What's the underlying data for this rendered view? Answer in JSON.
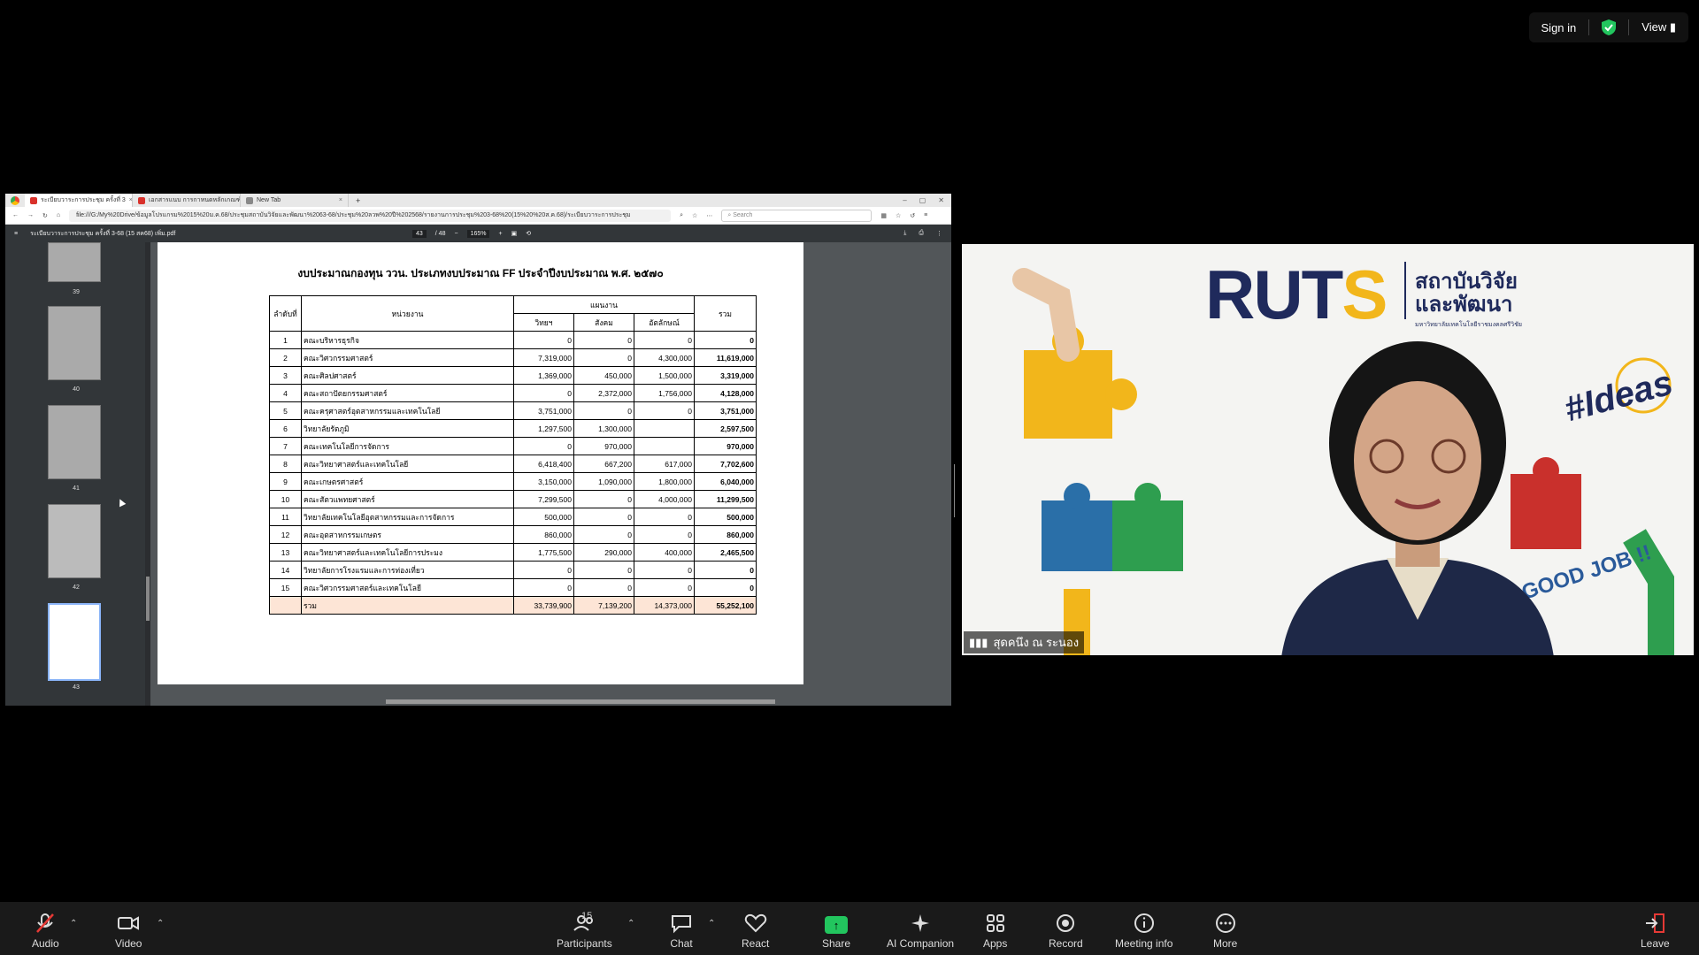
{
  "top_bar": {
    "sign_in": "Sign in",
    "view": "View"
  },
  "browser": {
    "tabs": [
      {
        "label": "ระเบียบวาระการประชุม ครั้งที่ 3"
      },
      {
        "label": "เอกสารแนบ การกาหนดหลักเกณฑ์"
      },
      {
        "label": "New Tab"
      }
    ],
    "url": "file:///G:/My%20Drive/ข้อมูลโปรแกรม%2015%20ม.ค.68/ประชุมสถาบันวิจัยและพัฒนา%2063-68/ประชุม%20ลวพ%20ปี%202568/รายงานการประชุม%203-68%20(15%20%20ส.ค.68)/ระเบียบวาระการประชุม",
    "search_placeholder": "Search"
  },
  "pdf": {
    "filename": "ระเบียบวาระการประชุม ครั้งที่ 3-68 (15 สค68) เพิ่ม.pdf",
    "page_current": "43",
    "page_total": "/ 48",
    "zoom": "165%",
    "thumbnails": [
      "39",
      "40",
      "41",
      "42",
      "43"
    ],
    "document_title": "งบประมาณกองทุน ววน. ประเภทงบประมาณ FF ประจำปีงบประมาณ พ.ศ. ๒๕๗๐",
    "table": {
      "headers": {
        "no": "ลำดับที่",
        "unit": "หน่วยงาน",
        "plan": "แผนงาน",
        "science": "วิทยฯ",
        "social": "สังคม",
        "identity": "อัตลักษณ์",
        "total": "รวม"
      },
      "rows": [
        {
          "no": "1",
          "unit": "คณะบริหารธุรกิจ",
          "science": "0",
          "social": "0",
          "identity": "0",
          "total": "0"
        },
        {
          "no": "2",
          "unit": "คณะวิศวกรรมศาสตร์",
          "science": "7,319,000",
          "social": "0",
          "identity": "4,300,000",
          "total": "11,619,000"
        },
        {
          "no": "3",
          "unit": "คณะศิลปศาสตร์",
          "science": "1,369,000",
          "social": "450,000",
          "identity": "1,500,000",
          "total": "3,319,000"
        },
        {
          "no": "4",
          "unit": "คณะสถาปัตยกรรมศาสตร์",
          "science": "0",
          "social": "2,372,000",
          "identity": "1,756,000",
          "total": "4,128,000"
        },
        {
          "no": "5",
          "unit": "คณะครุศาสตร์อุตสาหกรรมและเทคโนโลยี",
          "science": "3,751,000",
          "social": "0",
          "identity": "0",
          "total": "3,751,000"
        },
        {
          "no": "6",
          "unit": "วิทยาลัยรัตภูมิ",
          "science": "1,297,500",
          "social": "1,300,000",
          "identity": "",
          "total": "2,597,500"
        },
        {
          "no": "7",
          "unit": "คณะเทคโนโลยีการจัดการ",
          "science": "0",
          "social": "970,000",
          "identity": "",
          "total": "970,000"
        },
        {
          "no": "8",
          "unit": "คณะวิทยาศาสตร์และเทคโนโลยี",
          "science": "6,418,400",
          "social": "667,200",
          "identity": "617,000",
          "total": "7,702,600"
        },
        {
          "no": "9",
          "unit": "คณะเกษตรศาสตร์",
          "science": "3,150,000",
          "social": "1,090,000",
          "identity": "1,800,000",
          "total": "6,040,000"
        },
        {
          "no": "10",
          "unit": "คณะสัตวแพทยศาสตร์",
          "science": "7,299,500",
          "social": "0",
          "identity": "4,000,000",
          "total": "11,299,500"
        },
        {
          "no": "11",
          "unit": "วิทยาลัยเทคโนโลยีอุตสาหกรรมและการจัดการ",
          "science": "500,000",
          "social": "0",
          "identity": "0",
          "total": "500,000"
        },
        {
          "no": "12",
          "unit": "คณะอุตสาหกรรมเกษตร",
          "science": "860,000",
          "social": "0",
          "identity": "0",
          "total": "860,000"
        },
        {
          "no": "13",
          "unit": "คณะวิทยาศาสตร์และเทคโนโลยีการประมง",
          "science": "1,775,500",
          "social": "290,000",
          "identity": "400,000",
          "total": "2,465,500"
        },
        {
          "no": "14",
          "unit": "วิทยาลัยการโรงแรมและการท่องเที่ยว",
          "science": "0",
          "social": "0",
          "identity": "0",
          "total": "0"
        },
        {
          "no": "15",
          "unit": "คณะวิศวกรรมศาสตร์และเทคโนโลยี",
          "science": "0",
          "social": "0",
          "identity": "0",
          "total": "0"
        }
      ],
      "total_row": {
        "label": "รวม",
        "science": "33,739,900",
        "social": "7,139,200",
        "identity": "14,373,000",
        "total": "55,252,100"
      }
    }
  },
  "video": {
    "logo_text": "RUTS",
    "org_th_line1": "สถาบันวิจัย",
    "org_th_line2": "และพัฒนา",
    "org_sub": "มหาวิทยาลัยเทคโนโลยีราชมงคลศรีวิชัย",
    "ideas_text": "#Ideas",
    "goodjob_text": "GOOD JOB !!",
    "participant_name": "สุดคนึง ณ ระนอง"
  },
  "toolbar": {
    "audio": "Audio",
    "video": "Video",
    "participants": "Participants",
    "participants_count": "15",
    "chat": "Chat",
    "react": "React",
    "share": "Share",
    "ai_companion": "AI Companion",
    "apps": "Apps",
    "record": "Record",
    "meeting_info": "Meeting info",
    "more": "More",
    "leave": "Leave"
  }
}
